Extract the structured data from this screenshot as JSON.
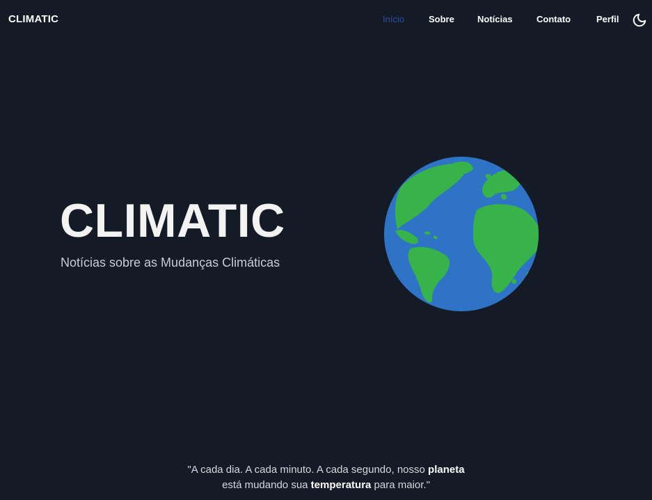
{
  "header": {
    "brand": "CLIMATIC",
    "nav": [
      {
        "label": "Início",
        "active": true
      },
      {
        "label": "Sobre",
        "active": false
      },
      {
        "label": "Notícias",
        "active": false
      },
      {
        "label": "Contato",
        "active": false
      },
      {
        "label": "Perfil",
        "active": false
      }
    ],
    "theme_toggle_icon": "moon-icon"
  },
  "hero": {
    "title": "CLIMATIC",
    "subtitle": "Notícias sobre as Mudanças Climáticas",
    "image_icon": "earth-globe-icon"
  },
  "quote": {
    "line1_start": "\"A cada dia. A cada minuto. A cada segundo, nosso ",
    "line1_bold": "planeta",
    "line2_start": "está mudando sua ",
    "line2_bold": "temperatura",
    "line2_end": " para maior.\""
  },
  "colors": {
    "background": "#151b26",
    "active_nav": "#2d4fa3",
    "ocean": "#2f73c7",
    "land": "#38b34a"
  }
}
